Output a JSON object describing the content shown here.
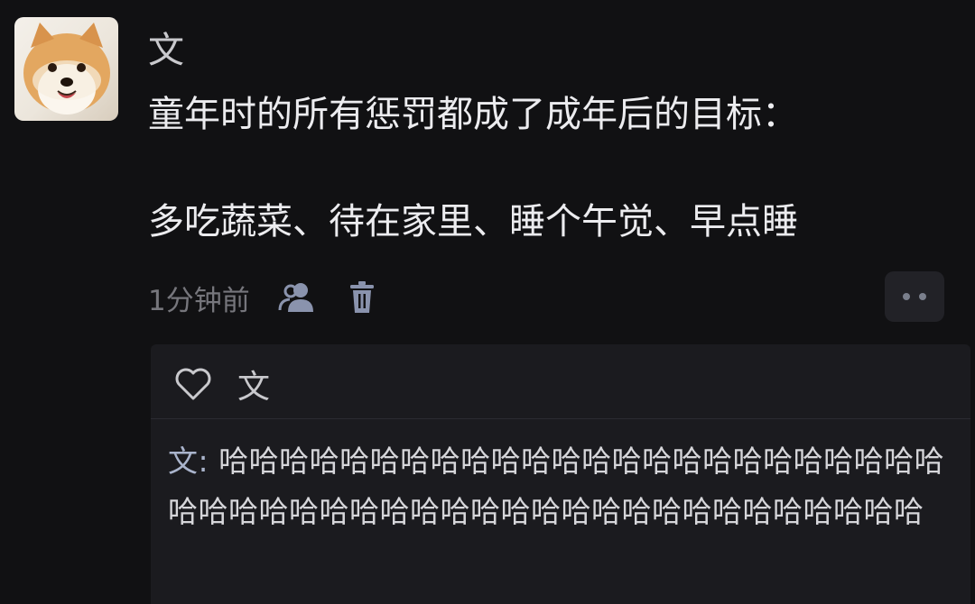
{
  "post": {
    "author": "文",
    "avatar_icon": "shiba-dog-avatar",
    "text_line1": "童年时的所有惩罚都成了成年后的目标：",
    "text_line2": "多吃蔬菜、待在家里、睡个午觉、早点睡",
    "time": "1分钟前",
    "icons": [
      "friends-visibility-icon",
      "trash-icon",
      "more-dots-icon"
    ]
  },
  "likes": {
    "icon": "heart-outline-icon",
    "name": "文"
  },
  "comment": {
    "author": "文:",
    "text": "哈哈哈哈哈哈哈哈哈哈哈哈哈哈哈哈哈哈哈哈哈哈哈哈哈哈哈哈哈哈哈哈哈哈哈哈哈哈哈哈哈哈哈哈哈哈哈哈哈"
  },
  "colors": {
    "background": "#111113",
    "comment_background": "#1b1b1f",
    "comment_name": "#aab4cc",
    "icon": "#8a93ad"
  }
}
